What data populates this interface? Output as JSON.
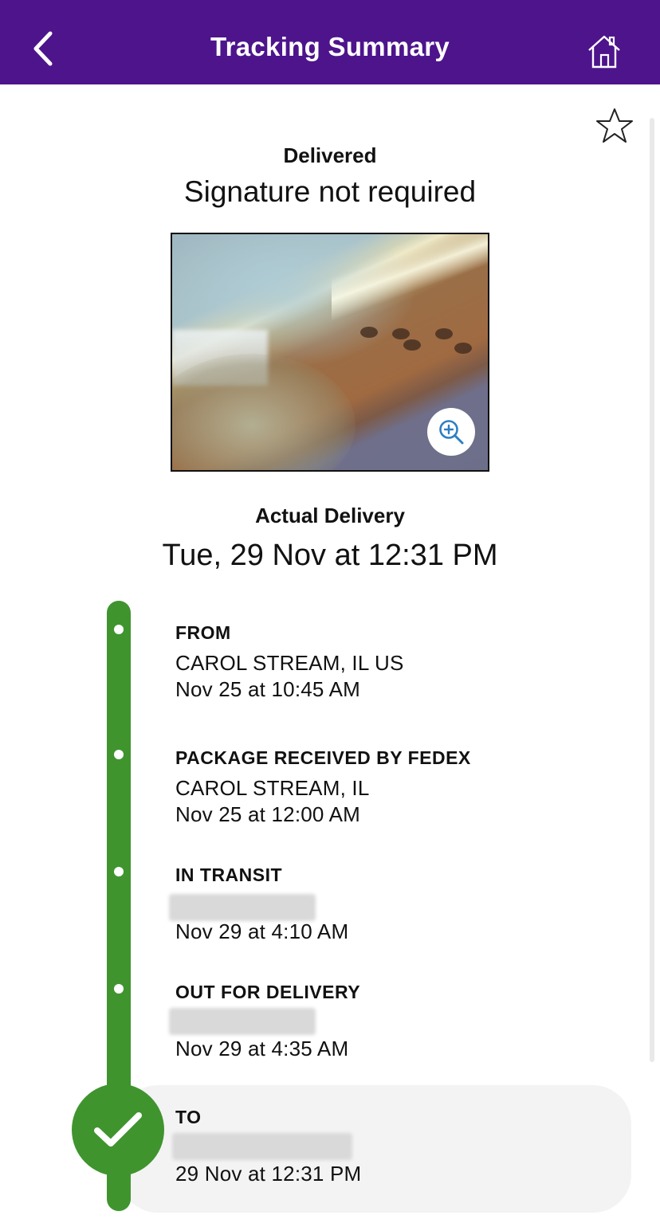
{
  "header": {
    "title": "Tracking Summary",
    "bar_color": "#4d148c",
    "back_icon": "chevron-left-icon",
    "home_icon": "home-icon"
  },
  "favorite_icon": "star-outline-icon",
  "status": {
    "title": "Delivered",
    "subtitle": "Signature not required"
  },
  "photo": {
    "zoom_icon": "zoom-in-icon"
  },
  "delivery": {
    "label": "Actual Delivery",
    "datetime": "Tue, 29 Nov at 12:31 PM"
  },
  "timeline": {
    "color": "#3f942e",
    "steps": [
      {
        "title": "FROM",
        "location": "CAROL STREAM, IL US",
        "time": "Nov 25 at 10:45 AM"
      },
      {
        "title": "PACKAGE RECEIVED BY FEDEX",
        "location": "CAROL STREAM, IL",
        "time": "Nov 25 at 12:00 AM"
      },
      {
        "title": "IN TRANSIT",
        "location_redacted": true,
        "time": "Nov 29 at 4:10 AM"
      },
      {
        "title": "OUT FOR DELIVERY",
        "location_redacted": true,
        "time": "Nov 29 at 4:35 AM"
      },
      {
        "title": "TO",
        "location_redacted": true,
        "time": "29 Nov at 12:31 PM",
        "status_icon": "checkmark-icon"
      }
    ]
  }
}
